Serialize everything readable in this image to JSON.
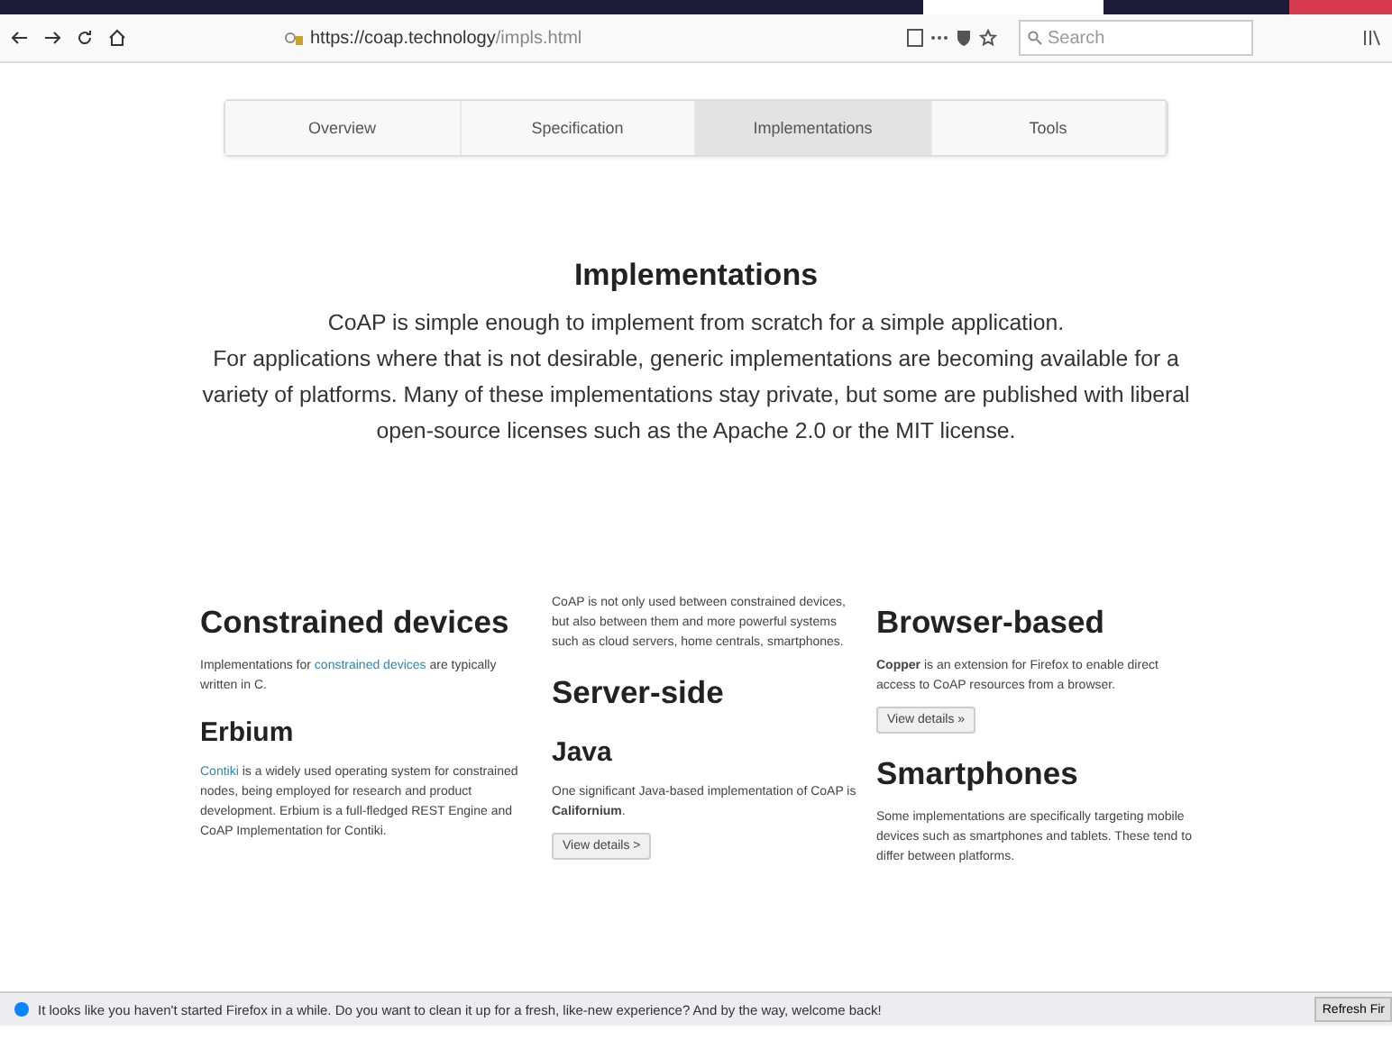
{
  "browser": {
    "url_host": "https://coap.technology",
    "url_path": "/impls.html",
    "search_placeholder": "Search"
  },
  "nav_tabs": [
    {
      "label": "Overview",
      "selected": false
    },
    {
      "label": "Specification",
      "selected": false
    },
    {
      "label": "Implementations",
      "selected": true
    },
    {
      "label": "Tools",
      "selected": false
    }
  ],
  "heading": "Implementations",
  "intro": [
    "CoAP is simple enough to implement from scratch for a simple application.",
    "For applications where that is not desirable, generic implementations are becoming available for a variety of platforms. Many of these implementations stay private, but some are published with liberal open-source licenses such as the Apache 2.0 or the MIT license."
  ],
  "columns": [
    {
      "blocks": [
        {
          "kind": "h2",
          "text": "Constrained devices"
        },
        {
          "kind": "p",
          "parts": [
            {
              "kind": "text",
              "text": "Implementations for "
            },
            {
              "kind": "link",
              "text": "constrained devices"
            },
            {
              "kind": "text",
              "text": " are typically written in C."
            }
          ]
        },
        {
          "kind": "h3",
          "text": "Erbium"
        },
        {
          "kind": "p",
          "parts": [
            {
              "kind": "link",
              "text": "Contiki"
            },
            {
              "kind": "text",
              "text": " is a widely used operating system for constrained nodes, being employed for research and product development. Erbium is a full-fledged REST Engine and CoAP Implementation for Contiki."
            }
          ]
        }
      ]
    },
    {
      "blocks": [
        {
          "kind": "p",
          "parts": [
            {
              "kind": "text",
              "text": "CoAP is not only used between constrained devices, but also between them and more powerful systems such as cloud servers, home centrals, smartphones."
            }
          ]
        },
        {
          "kind": "h2",
          "text": "Server-side"
        },
        {
          "kind": "h3",
          "text": "Java"
        },
        {
          "kind": "p",
          "parts": [
            {
              "kind": "text",
              "text": "One significant Java-based implementation of CoAP is "
            },
            {
              "kind": "bold",
              "text": "Californium"
            },
            {
              "kind": "text",
              "text": "."
            }
          ]
        },
        {
          "kind": "button",
          "text": "View details >"
        }
      ]
    },
    {
      "blocks": [
        {
          "kind": "h2",
          "text": "Browser-based"
        },
        {
          "kind": "p",
          "parts": [
            {
              "kind": "bold",
              "text": "Copper"
            },
            {
              "kind": "text",
              "text": " is an extension for Firefox to enable direct access to CoAP resources from a browser."
            }
          ]
        },
        {
          "kind": "button",
          "text": "View details »"
        },
        {
          "kind": "h2",
          "text": "Smartphones"
        },
        {
          "kind": "p",
          "parts": [
            {
              "kind": "text",
              "text": "Some implementations are specifically targeting mobile devices such as smartphones and tablets. These tend to differ between platforms."
            }
          ]
        }
      ]
    }
  ],
  "notification": {
    "message": "It looks like you haven't started Firefox in a while. Do you want to clean it up for a fresh, like-new experience? And by the way, welcome back!",
    "button": "Refresh Fir"
  }
}
